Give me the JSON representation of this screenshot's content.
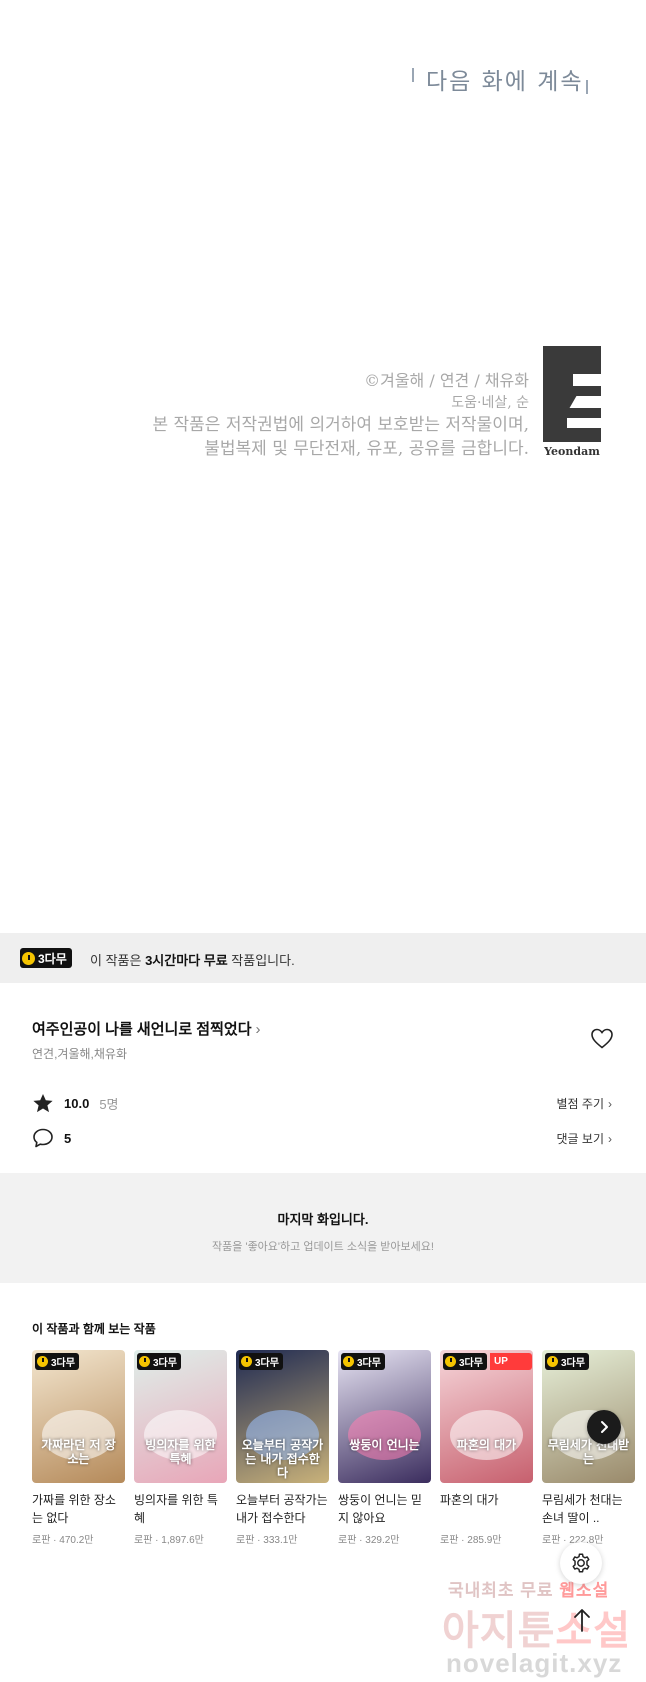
{
  "comic": {
    "to_be_continued": "다음 화에 계속",
    "credits": {
      "line1": "©겨울해 / 연견 / 채유화",
      "line2": "도움·네살, 순",
      "line3": "본 작품은 저작권법에 의거하여 보호받는 저작물이며,",
      "line4": "불법복제 및 무단전재, 유포, 공유를 금합니다."
    },
    "logo_text": "Yeondam"
  },
  "free_banner": {
    "badge": "3다무",
    "prefix": "이 작품은 ",
    "bold": "3시간마다 무료",
    "suffix": " 작품입니다."
  },
  "series": {
    "title": "여주인공이 나를 새언니로 점찍었다",
    "title_chevron": "›",
    "authors": "연견,겨울해,채유화",
    "rating": "10.0",
    "rating_count": "5명",
    "rate_link": "별점 주기",
    "comment_count": "5",
    "comment_link": "댓글 보기",
    "link_chevron": "›"
  },
  "last_episode": {
    "heading": "마지막 화입니다.",
    "sub": "작품을 '좋아요'하고 업데이트 소식을 받아보세요!"
  },
  "recommendations": {
    "heading": "이 작품과 함께 보는 작품",
    "items": [
      {
        "badge": "3다무",
        "cover_title": "가짜라던 저 장소는",
        "title": "가짜를 위한 장소는 없다",
        "meta": "로판 · 470.2만",
        "bg1": "#f3e6cf",
        "bg2": "#b58a5a",
        "glow": "#ffffff"
      },
      {
        "badge": "3다무",
        "cover_title": "빙의자를 위한 특혜",
        "title": "빙의자를 위한 특혜",
        "meta": "로판 · 1,897.6만",
        "bg1": "#dfeee9",
        "bg2": "#e8a6b8",
        "glow": "#ffffff"
      },
      {
        "badge": "3다무",
        "cover_title": "오늘부터 공작가는 내가 접수한다",
        "title": "오늘부터 공작가는 내가 접수한다",
        "meta": "로판 · 333.1만",
        "bg1": "#1f2a52",
        "bg2": "#c9b27a",
        "glow": "#9fc3ff"
      },
      {
        "badge": "3다무",
        "cover_title": "쌍둥이 언니는",
        "title": "쌍둥이 언니는 믿지 않아요",
        "meta": "로판 · 329.2만",
        "bg1": "#e7e4f3",
        "bg2": "#3b2d5e",
        "glow": "#ff7fb2"
      },
      {
        "badge": "3다무",
        "up": "UP",
        "cover_title": "파혼의 대가",
        "title": "파혼의 대가",
        "meta": "로판 · 285.9만",
        "bg1": "#f6d6da",
        "bg2": "#c7606e",
        "glow": "#ffffff"
      },
      {
        "badge": "3다무",
        "cover_title": "무림세가 천대받는",
        "title": "무림세가 천대는 손녀 딸이 ..",
        "meta": "로판 · 222.8만",
        "bg1": "#e6efd8",
        "bg2": "#9a8a6b",
        "glow": "#ffffff"
      }
    ]
  },
  "watermark": {
    "line1_a": "국내최초 무료 ",
    "line1_b": "웹소설",
    "line2_a": "아지툰",
    "line2_b": "소설",
    "line3": "novelagit.xyz"
  }
}
